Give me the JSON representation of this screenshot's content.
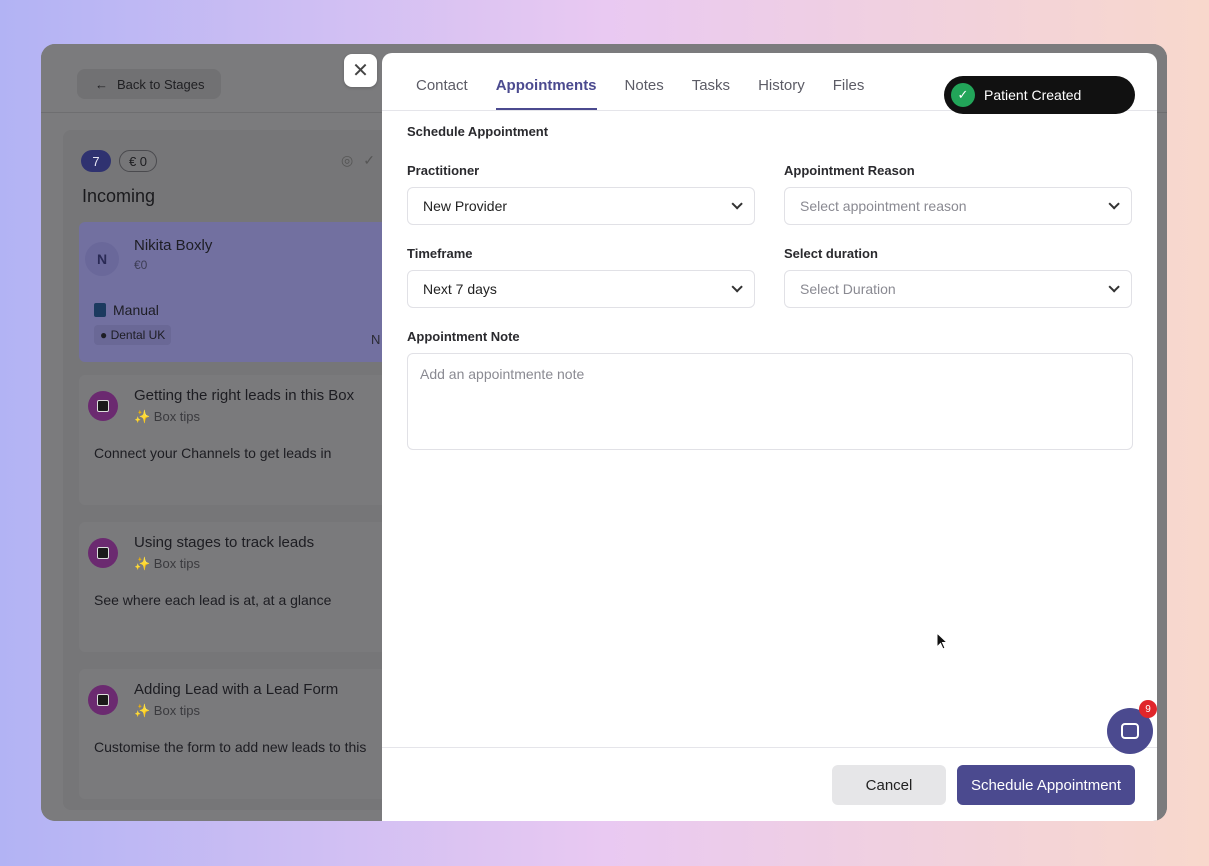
{
  "background": {
    "back_button": "Back to Stages",
    "column": {
      "count": "7",
      "amount": "€ 0",
      "title": "Incoming",
      "lead": {
        "initial": "N",
        "name": "Nikita Boxly",
        "amount": "€0",
        "source": "Manual",
        "tag": "Dental UK",
        "trailing": "N"
      },
      "tips": [
        {
          "title": "Getting the right leads in this Box",
          "sub": "✨ Box tips",
          "body": "Connect your Channels to get leads in"
        },
        {
          "title": "Using stages to track leads",
          "sub": "✨ Box tips",
          "body": "See where each lead is at, at a glance"
        },
        {
          "title": "Adding Lead with a Lead Form",
          "sub": "✨ Box tips",
          "body": "Customise the form to add new leads to this"
        }
      ]
    }
  },
  "tabs": [
    {
      "label": "Contact"
    },
    {
      "label": "Appointments",
      "active": true
    },
    {
      "label": "Notes"
    },
    {
      "label": "Tasks"
    },
    {
      "label": "History"
    },
    {
      "label": "Files"
    }
  ],
  "toast": {
    "text": "Patient Created",
    "icon": "check-icon",
    "color": "#22a559"
  },
  "form": {
    "section_title": "Schedule Appointment",
    "practitioner": {
      "label": "Practitioner",
      "value": "New Provider"
    },
    "reason": {
      "label": "Appointment Reason",
      "placeholder": "Select appointment reason"
    },
    "timeframe": {
      "label": "Timeframe",
      "value": "Next 7 days"
    },
    "duration": {
      "label": "Select duration",
      "placeholder": "Select Duration"
    },
    "note": {
      "label": "Appointment Note",
      "placeholder": "Add an appointmente note"
    }
  },
  "actions": {
    "cancel": "Cancel",
    "submit": "Schedule Appointment"
  },
  "chat": {
    "badge": "9"
  },
  "colors": {
    "accent": "#4b4a8f",
    "success": "#22a559",
    "badge": "#e0262b"
  }
}
